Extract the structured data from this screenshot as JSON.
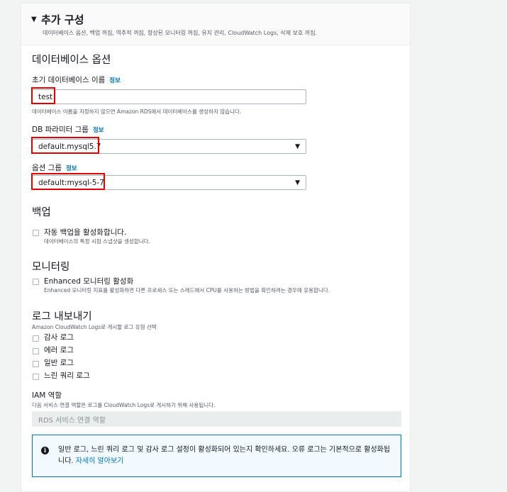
{
  "section": {
    "title": "추가 구성",
    "description": "데이터베이스 옵션, 백업 꺼짐, 역추적 꺼짐, 향상된 모니터링 꺼짐, 유지 관리, CloudWatch Logs, 삭제 보호 꺼짐."
  },
  "db_options": {
    "heading": "데이터베이스 옵션",
    "info_label": "정보",
    "initial_db_name": {
      "label": "초기 데이터베이스 이름",
      "value": "test",
      "hint": "데이터베이스 이름을 지정하지 않으면 Amazon RDS에서 데이터베이스를 생성하지 않습니다."
    },
    "param_group": {
      "label": "DB 파라미터 그룹",
      "value": "default.mysql5.7"
    },
    "option_group": {
      "label": "옵션 그룹",
      "value": "default:mysql-5-7"
    }
  },
  "backup": {
    "heading": "백업",
    "checkbox_label": "자동 백업을 활성화합니다.",
    "checkbox_desc": "데이터베이스의 특정 시점 스냅샷을 생성합니다."
  },
  "monitoring": {
    "heading": "모니터링",
    "checkbox_label": "Enhanced 모니터링 활성화",
    "checkbox_desc": "Enhanced 모니터링 지표를 활성화하면 다른 프로세스 또는 스레드에서 CPU를 사용하는 방법을 확인하려는 경우에 유용합니다."
  },
  "log_export": {
    "heading": "로그 내보내기",
    "desc": "Amazon CloudWatch Logs로 게시할 로그 유형 선택",
    "logs": [
      "감사 로그",
      "에러 로그",
      "일반 로그",
      "느린 쿼리 로그"
    ]
  },
  "iam": {
    "label": "IAM 역할",
    "desc": "다음 서비스 연결 역할은 로그를 CloudWatch Logs로 게시하기 위해 사용됩니다.",
    "value": "RDS 서비스 연결 역할"
  },
  "alert": {
    "text": "일반 로그, 느린 쿼리 로그 및 감사 로그 설정이 활성화되어 있는지 확인하세요. 오류 로그는 기본적으로 활성화됩니다.",
    "link": "자세히 알아보기"
  },
  "colors": {
    "link": "#0073bb",
    "highlight": "#e00000"
  }
}
